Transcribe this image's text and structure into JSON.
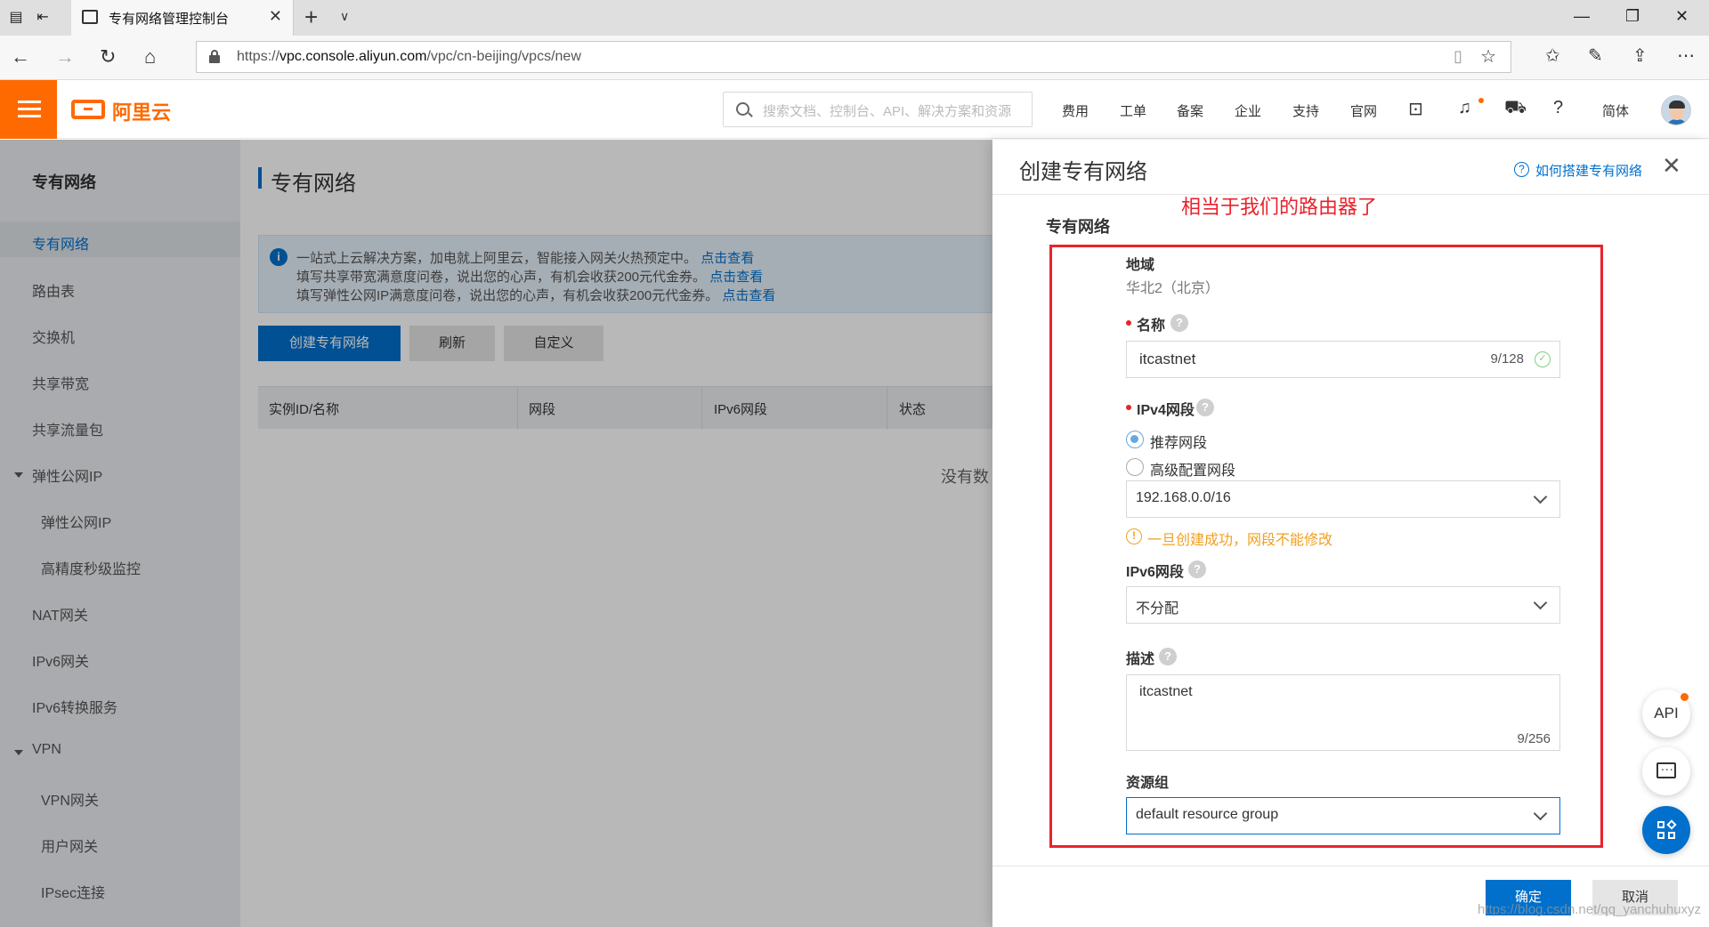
{
  "browser": {
    "tab_title": "专有网络管理控制台",
    "url_prefix": "https://",
    "url_host": "vpc.console.aliyun.com",
    "url_path": "/vpc/cn-beijing/vpcs/new"
  },
  "header": {
    "logo_text": "阿里云",
    "search_placeholder": "搜索文档、控制台、API、解决方案和资源",
    "links": [
      "费用",
      "工单",
      "备案",
      "企业",
      "支持",
      "官网"
    ],
    "lang": "简体"
  },
  "sidebar": {
    "title": "专有网络",
    "items": [
      {
        "label": "专有网络"
      },
      {
        "label": "路由表"
      },
      {
        "label": "交换机"
      },
      {
        "label": "共享带宽"
      },
      {
        "label": "共享流量包"
      },
      {
        "label": "弹性公网IP"
      },
      {
        "label": "弹性公网IP"
      },
      {
        "label": "高精度秒级监控"
      },
      {
        "label": "NAT网关"
      },
      {
        "label": "IPv6网关"
      },
      {
        "label": "IPv6转换服务"
      },
      {
        "label": "VPN"
      },
      {
        "label": "VPN网关"
      },
      {
        "label": "用户网关"
      },
      {
        "label": "IPsec连接"
      }
    ]
  },
  "main": {
    "title": "专有网络",
    "notice": {
      "line1": "一站式上云解决方案，加电就上阿里云，智能接入网关火热预定中。",
      "line2": "填写共享带宽满意度问卷，说出您的心声，有机会收获200元代金券。",
      "line3": "填写弹性公网IP满意度问卷，说出您的心声，有机会收获200元代金券。",
      "link": "点击查看"
    },
    "buttons": {
      "create": "创建专有网络",
      "refresh": "刷新",
      "customize": "自定义"
    },
    "table_headers": [
      "实例ID/名称",
      "网段",
      "IPv6网段",
      "状态"
    ],
    "empty_text": "没有数"
  },
  "drawer": {
    "title": "创建专有网络",
    "help_link": "如何搭建专有网络",
    "annotation": "相当于我们的路由器了",
    "section_title": "专有网络",
    "region": {
      "label": "地域",
      "value": "华北2（北京）"
    },
    "name": {
      "label": "名称",
      "value": "itcastnet",
      "count": "9/128"
    },
    "ipv4": {
      "label": "IPv4网段",
      "option_recommended": "推荐网段",
      "option_advanced": "高级配置网段",
      "value": "192.168.0.0/16",
      "warning": "一旦创建成功，网段不能修改"
    },
    "ipv6": {
      "label": "IPv6网段",
      "value": "不分配"
    },
    "description": {
      "label": "描述",
      "value": "itcastnet",
      "count": "9/256"
    },
    "resource_group": {
      "label": "资源组",
      "value": "default resource group"
    },
    "confirm": "确定",
    "cancel": "取消"
  },
  "floating": {
    "api": "API"
  },
  "watermark": "https://blog.csdn.net/qq_yanchuhuxyz"
}
